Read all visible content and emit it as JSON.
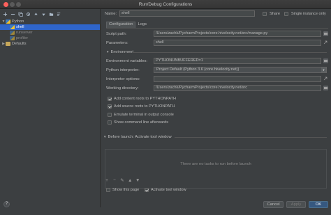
{
  "window": {
    "title": "Run/Debug Configurations"
  },
  "toolbar": {
    "buttons": [
      "add-icon",
      "remove-icon",
      "copy-icon",
      "settings-icon",
      "move-up-icon",
      "move-down-icon",
      "folder-icon",
      "sort-icon"
    ]
  },
  "tree": {
    "python_label": "Python",
    "items": [
      {
        "label": "shell",
        "selected": true
      },
      {
        "label": "runserver",
        "selected": false
      },
      {
        "label": "profiler",
        "selected": false
      }
    ],
    "defaults_label": "Defaults"
  },
  "form": {
    "name_label": "Name:",
    "name_value": "shell",
    "share_label": "Share",
    "single_instance_label": "Single instance only",
    "tabs": [
      "Configuration",
      "Logs"
    ],
    "script_path_label": "Script path:",
    "script_path_value": "/Users/zachk/PycharmProjects/core.hivelocity.net/src/manage.py",
    "parameters_label": "Parameters:",
    "parameters_value": "shell",
    "environment_section": "Environment",
    "env_vars_label": "Environment variables:",
    "env_vars_value": "PYTHONUNBUFFERED=1",
    "interpreter_label": "Python interpreter:",
    "interpreter_value": "Project Default (Python 3.6 (core.hivelocity.net))",
    "interpreter_options_label": "Interpreter options:",
    "interpreter_options_value": "",
    "working_dir_label": "Working directory:",
    "working_dir_value": "/Users/zachk/PycharmProjects/core.hivelocity.net/src",
    "add_content_roots_label": "Add content roots to PYTHONPATH",
    "add_source_roots_label": "Add source roots to PYTHONPATH",
    "emulate_terminal_label": "Emulate terminal in output console",
    "show_cmd_label": "Show command line afterwards",
    "before_launch_label": "Before launch: Activate tool window",
    "no_tasks_msg": "There are no tasks to run before launch",
    "task_toolbar": [
      "+",
      "−",
      "✎",
      "▲",
      "▼"
    ],
    "show_page_label": "Show this page",
    "activate_tool_window_label": "Activate tool window"
  },
  "buttons": {
    "help": "?",
    "cancel": "Cancel",
    "apply": "Apply",
    "ok": "OK"
  }
}
